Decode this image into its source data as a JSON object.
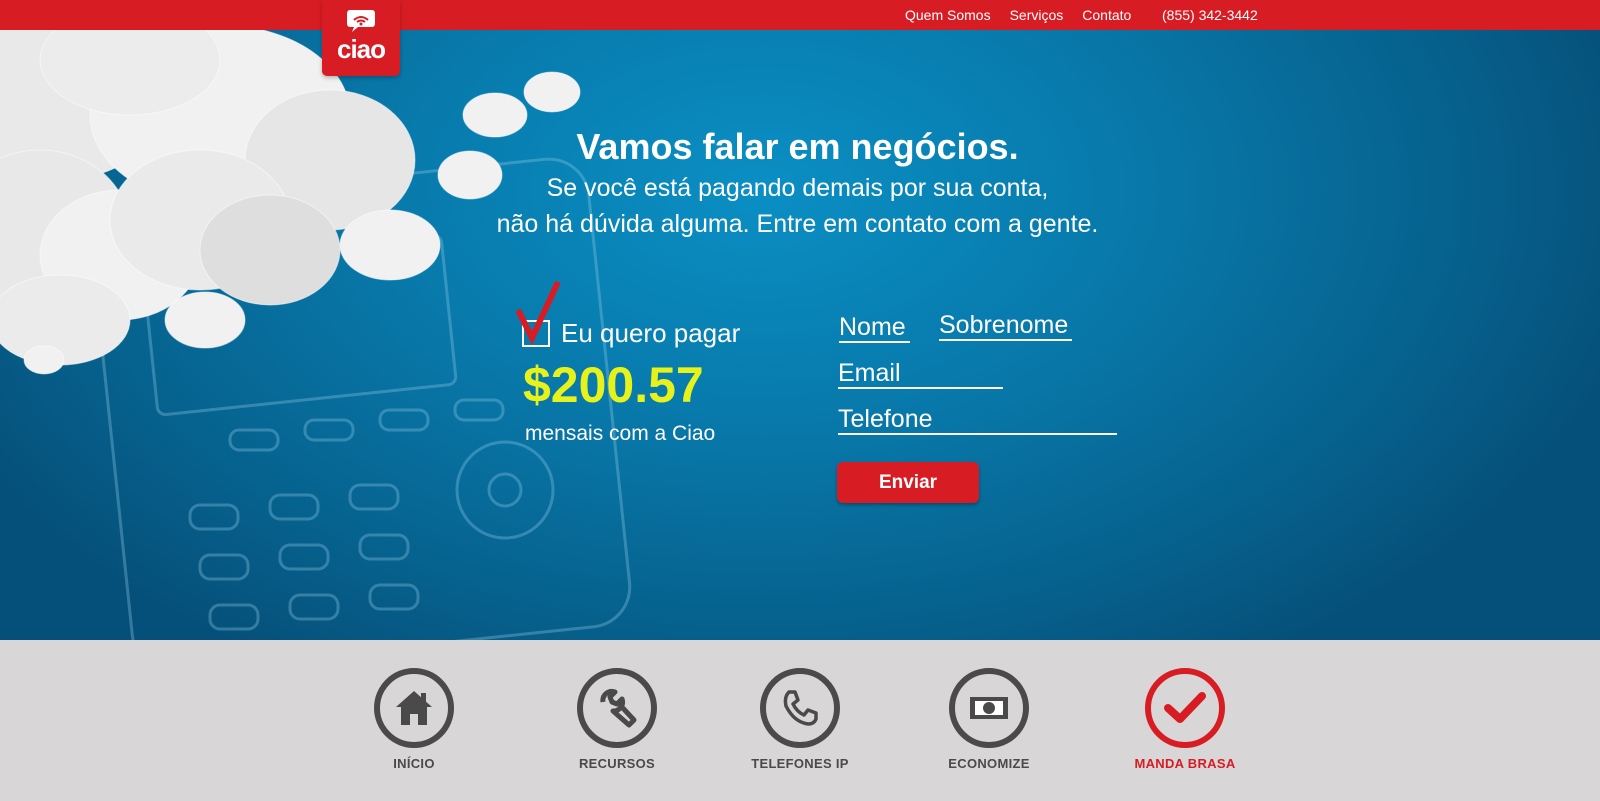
{
  "brand": {
    "logo_text": "ciao",
    "color": "#d81c24"
  },
  "topnav": {
    "items": [
      {
        "label": "Quem Somos"
      },
      {
        "label": "Serviços"
      },
      {
        "label": "Contato"
      }
    ],
    "phone": "(855) 342-3442"
  },
  "hero": {
    "headline": "Vamos falar em negócios.",
    "subtext_line1": "Se você está pagando demais por sua conta,",
    "subtext_line2": "não há dúvida alguma. Entre em contato com a gente.",
    "offer": {
      "checkbox_label": "Eu quero pagar",
      "price": "$200.57",
      "price_caption": "mensais com a Ciao",
      "price_color": "#e7f21a"
    },
    "form": {
      "first_name_placeholder": "Nome",
      "last_name_placeholder": "Sobrenome",
      "email_placeholder": "Email",
      "phone_placeholder": "Telefone",
      "submit_label": "Enviar"
    }
  },
  "bottom_nav": {
    "items": [
      {
        "label": "INÍCIO",
        "icon": "home-icon"
      },
      {
        "label": "RECURSOS",
        "icon": "wrench-icon"
      },
      {
        "label": "TELEFONES IP",
        "icon": "phone-icon"
      },
      {
        "label": "ECONOMIZE",
        "icon": "money-icon"
      },
      {
        "label": "MANDA BRASA",
        "icon": "checkmark-icon",
        "active": true
      }
    ],
    "active_color": "#d81c24",
    "inactive_color": "#4a4a4a"
  }
}
